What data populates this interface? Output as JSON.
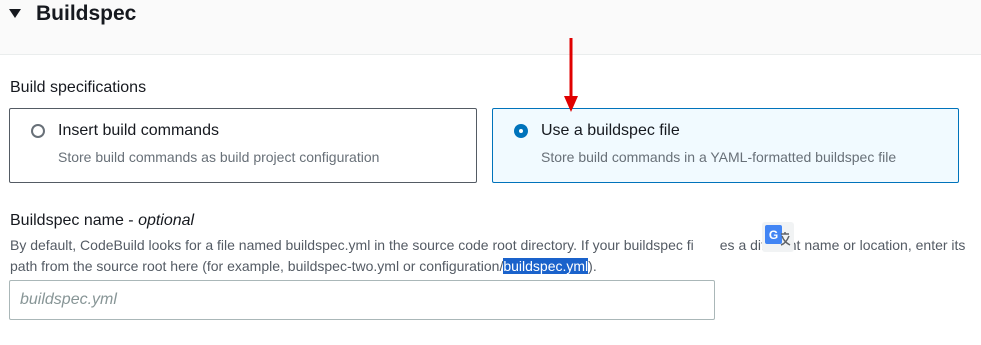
{
  "section": {
    "title": "Buildspec"
  },
  "build_specs": {
    "label": "Build specifications",
    "options": [
      {
        "title": "Insert build commands",
        "description": "Store build commands as build project configuration",
        "selected": false
      },
      {
        "title": "Use a buildspec file",
        "description": "Store build commands in a YAML-formatted buildspec file",
        "selected": true
      }
    ]
  },
  "buildspec_name": {
    "label": "Buildspec name - ",
    "optional": "optional",
    "description_pre": "By default, CodeBuild looks for a file named buildspec.yml in the source code root directory. If your buildspec fi",
    "description_mid": "es a different name or location, enter its path from the source root here (for example, buildspec-two.yml or configuration/",
    "description_highlight": "buildspec.yml",
    "description_post": ").",
    "placeholder": "buildspec.yml",
    "value": ""
  },
  "icons": {
    "caret": "caret-down-icon",
    "annotation_arrow": "red-arrow-down-icon",
    "translate": "google-translate-icon"
  },
  "colors": {
    "selected_border": "#0073bb",
    "selected_bg": "#f1faff",
    "arrow": "#e00000",
    "highlight": "#1a62cb"
  }
}
